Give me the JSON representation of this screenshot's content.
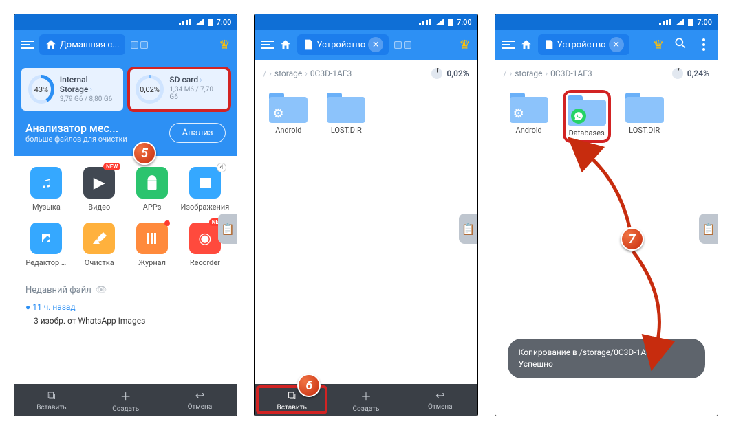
{
  "status": {
    "time": "7:00"
  },
  "screen1": {
    "toolbar": {
      "location": "Домашняя с..."
    },
    "storage": {
      "internal": {
        "name": "Internal Storage",
        "sub": "3,79 G6 / 8,80 G6",
        "pct": "43%"
      },
      "sd": {
        "name": "SD card",
        "sub": "1,34 M6 / 7,70 G6",
        "pct": "0,02%"
      }
    },
    "analyzer": {
      "title": "Анализатор мес...",
      "subtitle": "больше файлов для очистки",
      "button": "Анализ"
    },
    "grid": {
      "music": "Музыка",
      "video": "Видео",
      "apps": "APPs",
      "images": "Изображения",
      "editor": "Редактор те...",
      "cleaner": "Очистка",
      "journal": "Журнал",
      "recorder": "Recorder",
      "new_badge": "NEW",
      "img_count": "4"
    },
    "recent": {
      "header": "Недавний файл",
      "when": "11 ч. назад",
      "item": "3 изобр. от WhatsApp Images"
    },
    "bottom": {
      "paste": "Вставить",
      "create": "Создать",
      "cancel": "Отмена"
    }
  },
  "screen2": {
    "toolbar": {
      "location": "Устройство"
    },
    "breadcrumb": {
      "seg1": "storage",
      "seg2": "0C3D-1AF3",
      "pct": "0,02%"
    },
    "folders": {
      "android": "Android",
      "lostdir": "LOST.DIR"
    },
    "bottom": {
      "paste": "Вставить",
      "create": "Создать",
      "cancel": "Отмена"
    }
  },
  "screen3": {
    "toolbar": {
      "location": "Устройство"
    },
    "breadcrumb": {
      "seg1": "storage",
      "seg2": "0C3D-1AF3",
      "pct": "0,24%"
    },
    "folders": {
      "android": "Android",
      "databases": "Databases",
      "lostdir": "LOST.DIR"
    },
    "toast": {
      "line1": "Копирование в /storage/0C3D-1AF3",
      "line2": "Успешно"
    }
  },
  "steps": {
    "s5": "5",
    "s6": "6",
    "s7": "7"
  }
}
